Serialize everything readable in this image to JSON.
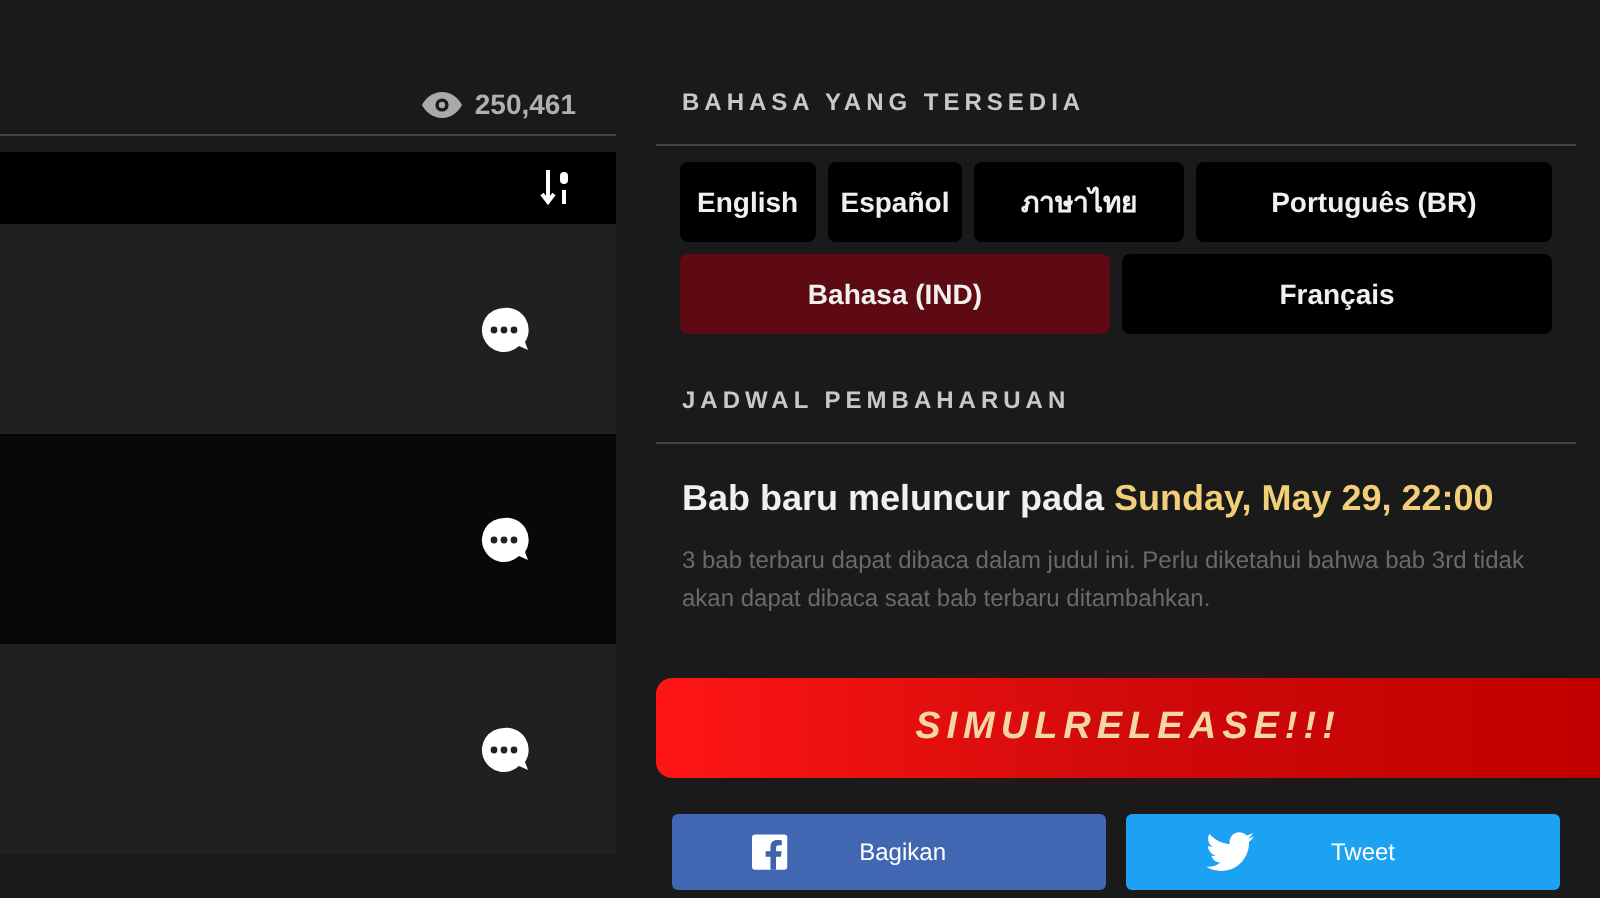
{
  "views": "250,461",
  "chapter_rows": [
    {
      "dimmed": false
    },
    {
      "dimmed": true
    },
    {
      "dimmed": false
    }
  ],
  "languages": {
    "title": "BAHASA YANG TERSEDIA",
    "options": [
      {
        "label": "English",
        "selected": false
      },
      {
        "label": "Español",
        "selected": false
      },
      {
        "label": "ภาษาไทย",
        "selected": false
      },
      {
        "label": "Português (BR)",
        "selected": false
      },
      {
        "label": "Bahasa (IND)",
        "selected": true
      },
      {
        "label": "Français",
        "selected": false
      }
    ]
  },
  "schedule": {
    "title": "JADWAL PEMBAHARUAN",
    "lead": "Bab baru meluncur pada",
    "time": "Sunday, May 29, 22:00",
    "note": "3 bab terbaru dapat dibaca dalam judul ini. Perlu diketahui bahwa bab 3rd tidak akan dapat dibaca saat bab terbaru ditambahkan."
  },
  "banner": "SIMULRELEASE!!!",
  "share": [
    {
      "kind": "facebook",
      "label": "Bagikan"
    },
    {
      "kind": "twitter",
      "label": "Tweet"
    }
  ]
}
